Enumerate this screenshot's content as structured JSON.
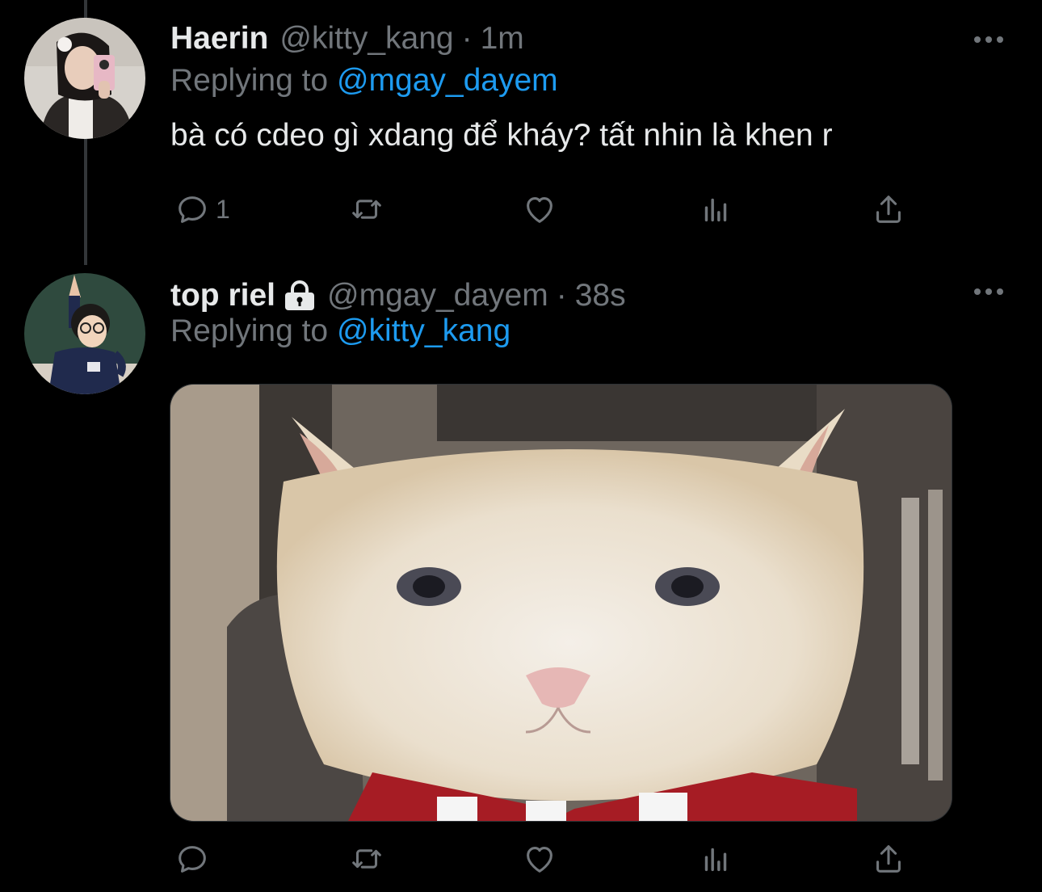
{
  "colors": {
    "background": "#000000",
    "text_primary": "#e7e9ea",
    "text_secondary": "#71767b",
    "link": "#1d9bf0",
    "thread_line": "#333639"
  },
  "tweets": [
    {
      "name": "Haerin",
      "handle": "@kitty_kang",
      "separator": "·",
      "time": "1m",
      "replying_prefix": "Replying to ",
      "replying_handle": "@mgay_dayem",
      "text": "bà có cdeo gì xdang để kháy? tất nhin là khen r",
      "reply_count": "1",
      "icons": {
        "avatar": "avatar-photo",
        "more": "more-dots-icon",
        "reply": "reply-icon",
        "retweet": "retweet-icon",
        "like": "heart-icon",
        "views": "views-icon",
        "share": "share-icon"
      }
    },
    {
      "name": "top riel",
      "protected_icon": "lock-icon",
      "handle": "@mgay_dayem",
      "separator": "·",
      "time": "38s",
      "replying_prefix": "Replying to ",
      "replying_handle": "@kitty_kang",
      "media": "cat-with-red-bow-tie-image",
      "reply_count": "",
      "icons": {
        "avatar": "avatar-photo",
        "more": "more-dots-icon",
        "reply": "reply-icon",
        "retweet": "retweet-icon",
        "like": "heart-icon",
        "views": "views-icon",
        "share": "share-icon"
      }
    }
  ]
}
